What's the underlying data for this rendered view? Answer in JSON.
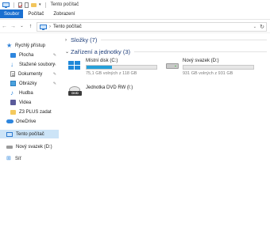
{
  "window": {
    "title": "Tento počítač"
  },
  "ribbon": {
    "tabs": [
      {
        "label": "Soubor"
      },
      {
        "label": "Počítač"
      },
      {
        "label": "Zobrazení"
      }
    ]
  },
  "address": {
    "path": "Tento počítač",
    "separator": "›"
  },
  "navpane": {
    "items": [
      {
        "label": "Rychlý přístup",
        "icon": "star-icon"
      },
      {
        "label": "Plocha",
        "icon": "desktop-icon",
        "pinned": true
      },
      {
        "label": "Stažené soubory",
        "icon": "download-icon",
        "pinned": true
      },
      {
        "label": "Dokumenty",
        "icon": "documents-icon",
        "pinned": true
      },
      {
        "label": "Obrázky",
        "icon": "pictures-icon",
        "pinned": true
      },
      {
        "label": "Hudba",
        "icon": "music-icon"
      },
      {
        "label": "Videa",
        "icon": "video-icon"
      },
      {
        "label": "Z3 PLUS zadat",
        "icon": "folder-icon"
      },
      {
        "label": "OneDrive",
        "icon": "cloud-icon"
      },
      {
        "label": "Tento počítač",
        "icon": "computer-icon",
        "selected": true
      },
      {
        "label": "Nový svazek (D:)",
        "icon": "drive-icon"
      },
      {
        "label": "Síť",
        "icon": "network-icon"
      }
    ]
  },
  "content": {
    "folders_group": {
      "label": "Složky (7)",
      "collapsed": true
    },
    "devices_group": {
      "label": "Zařízení a jednotky (3)"
    },
    "drives": [
      {
        "name": "Místní disk (C:)",
        "free": "75,1 GB volných z 118 GB",
        "used_fraction": 0.364,
        "icon": "windows-drive-icon"
      },
      {
        "name": "Nový svazek (D:)",
        "free": "931 GB volných z 931 GB",
        "used_fraction": 0.0,
        "icon": "hard-drive-icon"
      },
      {
        "name": "Jednotka DVD RW (I:)",
        "icon": "dvd-drive-icon"
      }
    ]
  },
  "colors": {
    "accent": "#1a6fd0",
    "selection": "#cce4f7",
    "bar_fill": "#26a0da",
    "group_header": "#1e3e7a"
  }
}
